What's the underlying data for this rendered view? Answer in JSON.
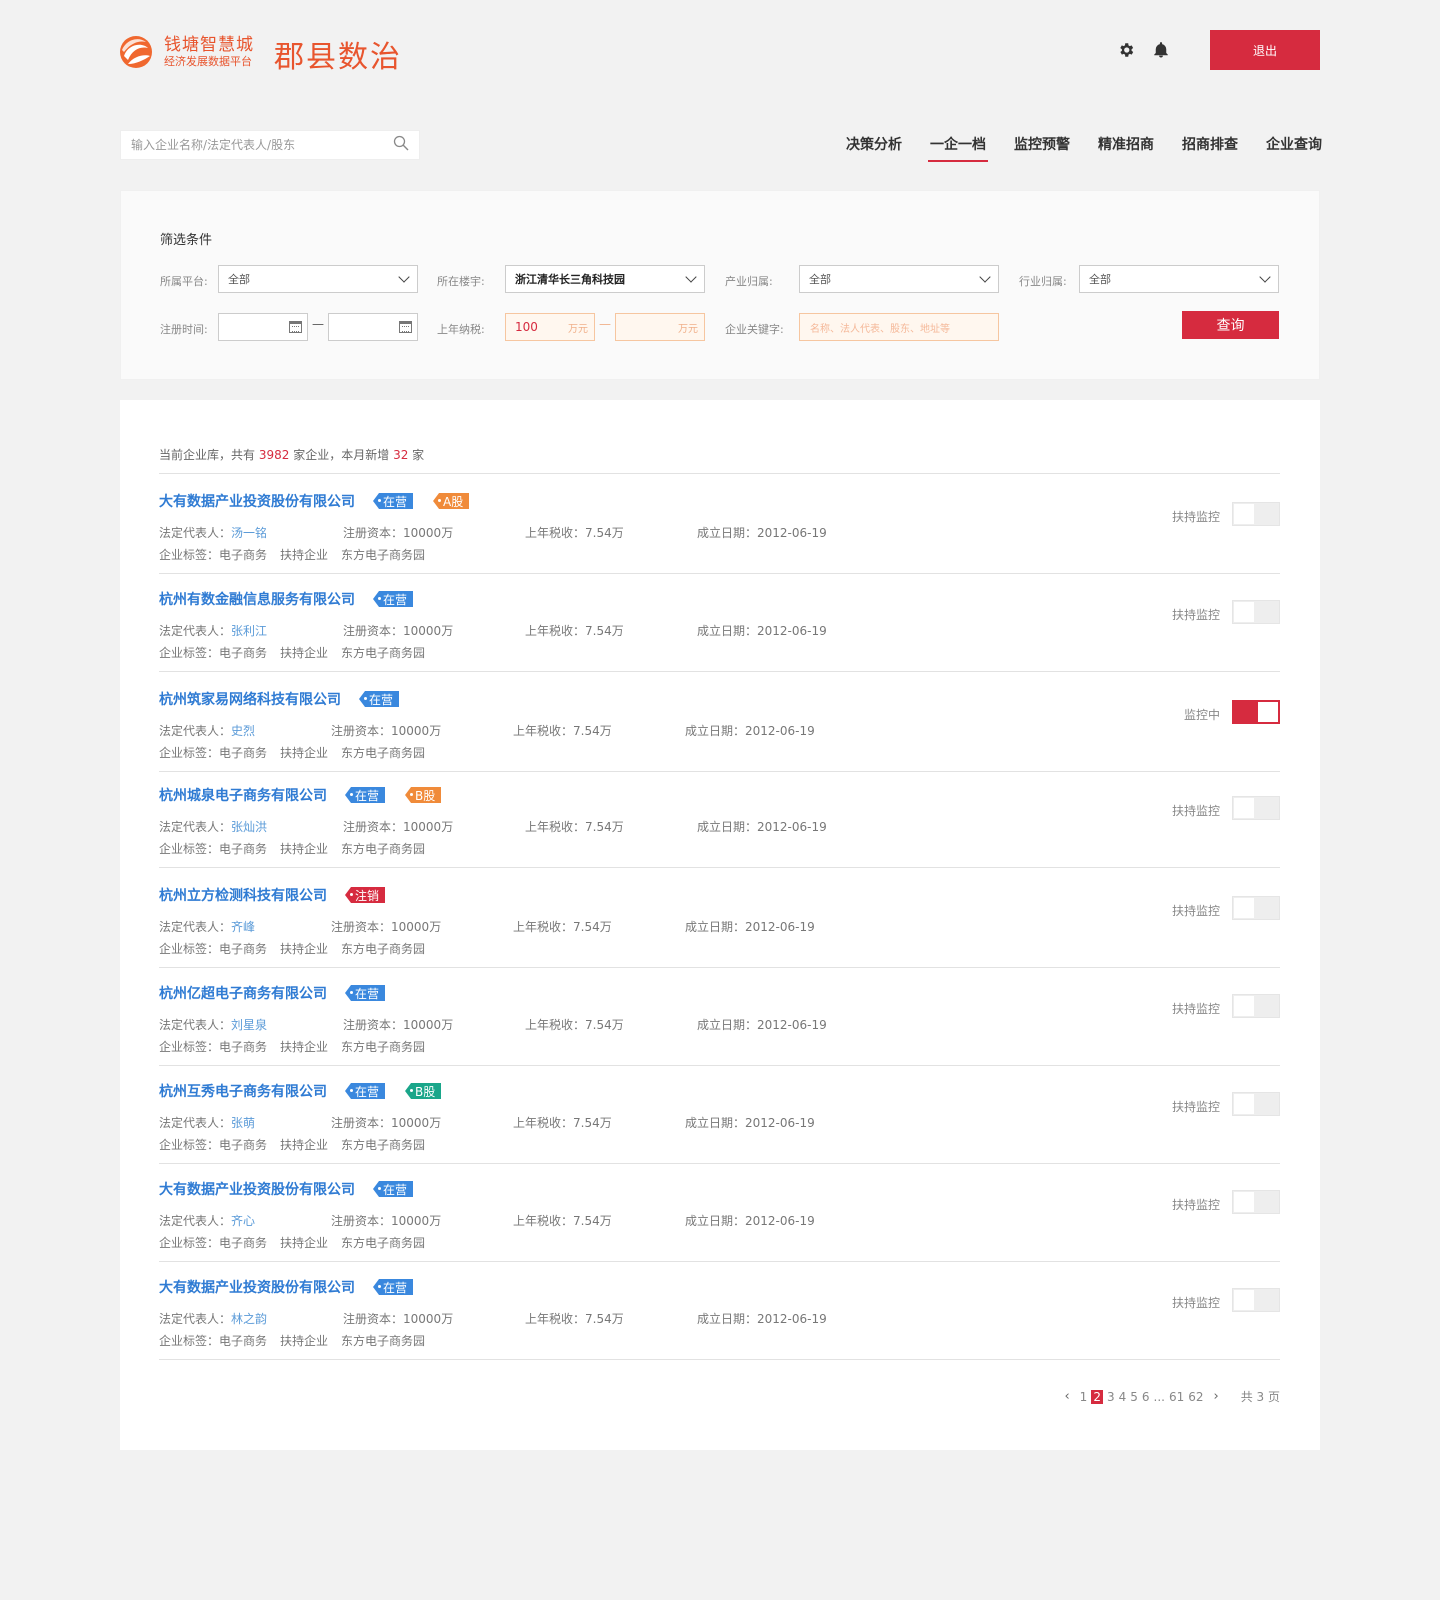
{
  "header": {
    "logo_main": "钱塘智慧城",
    "logo_sub": "经济发展数据平台",
    "app_title": "郡县数治",
    "logout_label": "退出"
  },
  "search": {
    "placeholder": "输入企业名称/法定代表人/股东"
  },
  "nav": {
    "items": [
      {
        "label": "决策分析"
      },
      {
        "label": "一企一档",
        "active": true
      },
      {
        "label": "监控预警"
      },
      {
        "label": "精准招商"
      },
      {
        "label": "招商排查"
      },
      {
        "label": "企业查询"
      }
    ]
  },
  "filter": {
    "title": "筛选条件",
    "platform_label": "所属平台:",
    "platform_value": "全部",
    "building_label": "所在楼宇:",
    "building_value": "浙江清华长三角科技园",
    "industry_label": "产业归属:",
    "industry_value": "全部",
    "sector_label": "行业归属:",
    "sector_value": "全部",
    "regtime_label": "注册时间:",
    "tax_label": "上年纳税:",
    "tax_min": "100",
    "tax_unit": "万元",
    "keyword_label": "企业关键字:",
    "keyword_placeholder": "名称、法人代表、股东、地址等",
    "query_label": "查询",
    "dash": "—"
  },
  "summary": {
    "prefix": "当前企业库，共有",
    "total": "3982",
    "mid": "家企业，本月新增",
    "new_count": "32",
    "suffix": "家"
  },
  "labels": {
    "legal_rep": "法定代表人：",
    "capital": "注册资本：",
    "tax": "上年税收：",
    "founded": "成立日期：",
    "tags": "企业标签："
  },
  "companies": [
    {
      "name": "大有数据产业投资股份有限公司",
      "status": "在营",
      "status_color": "blue",
      "extra_tag": "A股",
      "extra_color": "orange",
      "legal_rep": "汤一铭",
      "capital": "10000万",
      "tax": "7.54万",
      "founded": "2012-06-19",
      "tags": [
        "电子商务",
        "扶持企业",
        "东方电子商务园"
      ],
      "monitor_label": "扶持监控",
      "monitoring": false
    },
    {
      "name": "杭州有数金融信息服务有限公司",
      "status": "在营",
      "status_color": "blue",
      "extra_tag": "",
      "legal_rep": "张利江",
      "capital": "10000万",
      "tax": "7.54万",
      "founded": "2012-06-19",
      "tags": [
        "电子商务",
        "扶持企业",
        "东方电子商务园"
      ],
      "monitor_label": "扶持监控",
      "monitoring": false
    },
    {
      "name": "杭州筑家易网络科技有限公司",
      "status": "在营",
      "status_color": "blue",
      "extra_tag": "",
      "legal_rep": "史烈",
      "capital": "10000万",
      "tax": "7.54万",
      "founded": "2012-06-19",
      "tags": [
        "电子商务",
        "扶持企业",
        "东方电子商务园"
      ],
      "monitor_label": "监控中",
      "monitoring": true
    },
    {
      "name": "杭州城泉电子商务有限公司",
      "status": "在营",
      "status_color": "blue",
      "extra_tag": "B股",
      "extra_color": "orange",
      "legal_rep": "张灿洪",
      "capital": "10000万",
      "tax": "7.54万",
      "founded": "2012-06-19",
      "tags": [
        "电子商务",
        "扶持企业",
        "东方电子商务园"
      ],
      "monitor_label": "扶持监控",
      "monitoring": false
    },
    {
      "name": "杭州立方检测科技有限公司",
      "status": "注销",
      "status_color": "red",
      "extra_tag": "",
      "legal_rep": "齐峰",
      "capital": "10000万",
      "tax": "7.54万",
      "founded": "2012-06-19",
      "tags": [
        "电子商务",
        "扶持企业",
        "东方电子商务园"
      ],
      "monitor_label": "扶持监控",
      "monitoring": false
    },
    {
      "name": "杭州亿超电子商务有限公司",
      "status": "在营",
      "status_color": "blue",
      "extra_tag": "",
      "legal_rep": "刘星泉",
      "capital": "10000万",
      "tax": "7.54万",
      "founded": "2012-06-19",
      "tags": [
        "电子商务",
        "扶持企业",
        "东方电子商务园"
      ],
      "monitor_label": "扶持监控",
      "monitoring": false
    },
    {
      "name": "杭州互秀电子商务有限公司",
      "status": "在营",
      "status_color": "blue",
      "extra_tag": "B股",
      "extra_color": "green",
      "legal_rep": "张萌",
      "capital": "10000万",
      "tax": "7.54万",
      "founded": "2012-06-19",
      "tags": [
        "电子商务",
        "扶持企业",
        "东方电子商务园"
      ],
      "monitor_label": "扶持监控",
      "monitoring": false
    },
    {
      "name": "大有数据产业投资股份有限公司",
      "status": "在营",
      "status_color": "blue",
      "extra_tag": "",
      "legal_rep": "齐心",
      "capital": "10000万",
      "tax": "7.54万",
      "founded": "2012-06-19",
      "tags": [
        "电子商务",
        "扶持企业",
        "东方电子商务园"
      ],
      "monitor_label": "扶持监控",
      "monitoring": false
    },
    {
      "name": "大有数据产业投资股份有限公司",
      "status": "在营",
      "status_color": "blue",
      "extra_tag": "",
      "legal_rep": "林之韵",
      "capital": "10000万",
      "tax": "7.54万",
      "founded": "2012-06-19",
      "tags": [
        "电子商务",
        "扶持企业",
        "东方电子商务园"
      ],
      "monitor_label": "扶持监控",
      "monitoring": false
    }
  ],
  "pagination": {
    "pages": [
      "1",
      "2",
      "3",
      "4",
      "5",
      "6",
      "...",
      "61",
      "62"
    ],
    "current": "2",
    "total_label": "共 3 页"
  },
  "colors": {
    "accent": "#d62b3f",
    "link": "#2f7bd3",
    "brand": "#e8552e"
  },
  "icons": {
    "settings": "gear-icon",
    "notify": "bell-icon",
    "search": "search-icon",
    "calendar": "calendar-icon"
  }
}
